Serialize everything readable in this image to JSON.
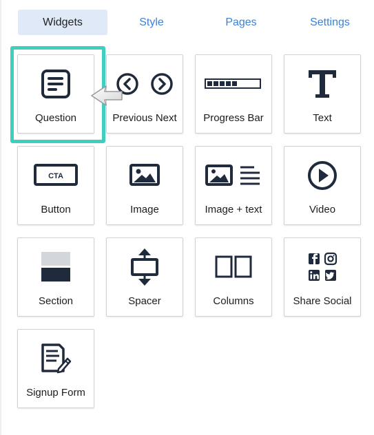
{
  "tabs": [
    {
      "label": "Widgets",
      "active": true
    },
    {
      "label": "Style",
      "active": false
    },
    {
      "label": "Pages",
      "active": false
    },
    {
      "label": "Settings",
      "active": false
    }
  ],
  "widgets": [
    {
      "label": "Question",
      "icon": "question-icon"
    },
    {
      "label": "Previous Next",
      "icon": "previous-next-icon"
    },
    {
      "label": "Progress Bar",
      "icon": "progress-bar-icon"
    },
    {
      "label": "Text",
      "icon": "text-icon"
    },
    {
      "label": "Button",
      "icon": "button-cta-icon",
      "icon_text": "CTA"
    },
    {
      "label": "Image",
      "icon": "image-icon"
    },
    {
      "label": "Image + text",
      "icon": "image-text-icon"
    },
    {
      "label": "Video",
      "icon": "video-play-icon"
    },
    {
      "label": "Section",
      "icon": "section-icon"
    },
    {
      "label": "Spacer",
      "icon": "spacer-icon"
    },
    {
      "label": "Columns",
      "icon": "columns-icon"
    },
    {
      "label": "Share Social",
      "icon": "share-social-icon"
    },
    {
      "label": "Signup Form",
      "icon": "signup-form-icon"
    }
  ],
  "colors": {
    "accent_tab": "#3b82d6",
    "active_tab_bg": "#dfe9f8",
    "highlight": "#3ecfbf",
    "icon": "#1f2a3c"
  }
}
